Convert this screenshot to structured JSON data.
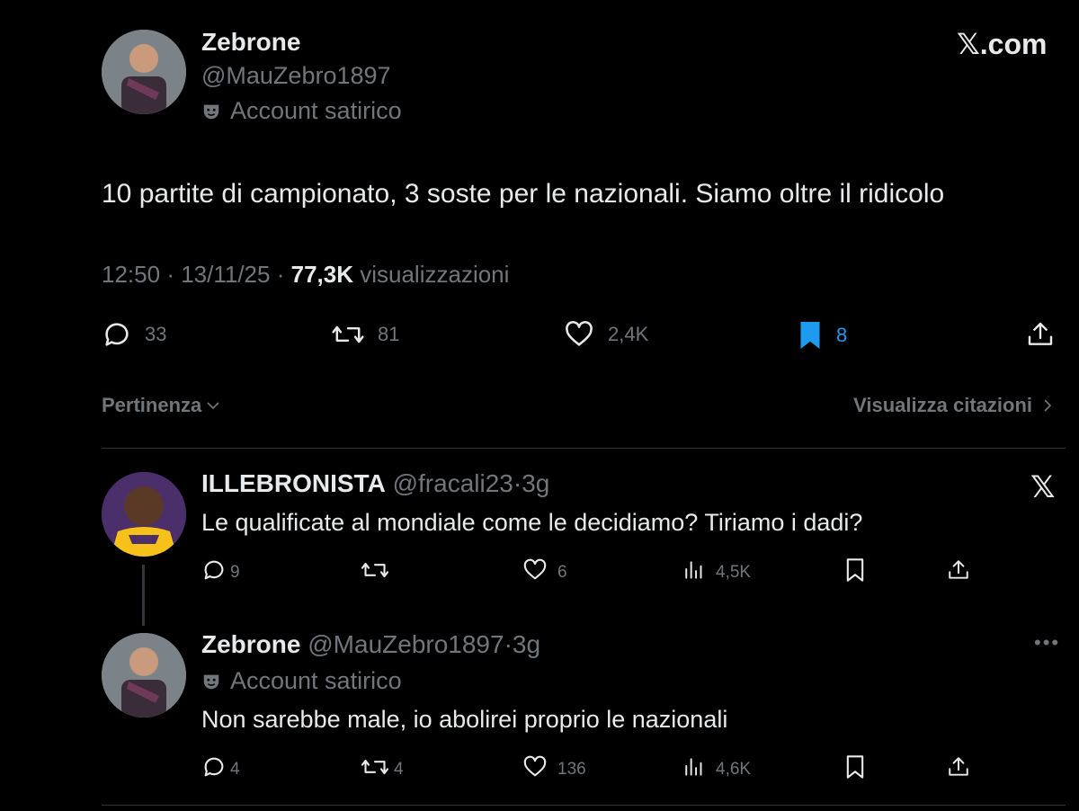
{
  "brand": {
    "logo_text": "𝕏.com"
  },
  "main_tweet": {
    "author_name": "Zebrone",
    "author_handle": "@MauZebro1897",
    "label_icon": "theater-mask-icon",
    "label_text": "Account satirico",
    "text": "10 partite di campionato, 3 soste per le nazionali. Siamo oltre il ridicolo",
    "time": "12:50",
    "date": "13/11/25",
    "views_count": "77,3K",
    "views_label": "visualizzazioni",
    "actions": {
      "replies": "33",
      "reposts": "81",
      "likes": "2,4K",
      "bookmarks": "8"
    },
    "bookmark_color": "#1d9bf0"
  },
  "replies_bar": {
    "sort_label": "Pertinenza",
    "quotes_label": "Visualizza citazioni"
  },
  "reply_1": {
    "author_name": "ILLEBRONISTA",
    "author_handle": "@fracali23",
    "age": "3g",
    "text": "Le qualificate al mondiale come le decidiamo? Tiriamo i dadi?",
    "actions": {
      "replies": "9",
      "reposts": "",
      "likes": "6",
      "views": "4,5K"
    }
  },
  "reply_2": {
    "author_name": "Zebrone",
    "author_handle": "@MauZebro1897",
    "age": "3g",
    "label_text": "Account satirico",
    "text": "Non sarebbe male, io abolirei proprio le nazionali",
    "actions": {
      "replies": "4",
      "reposts": "4",
      "likes": "136",
      "views": "4,6K"
    }
  }
}
